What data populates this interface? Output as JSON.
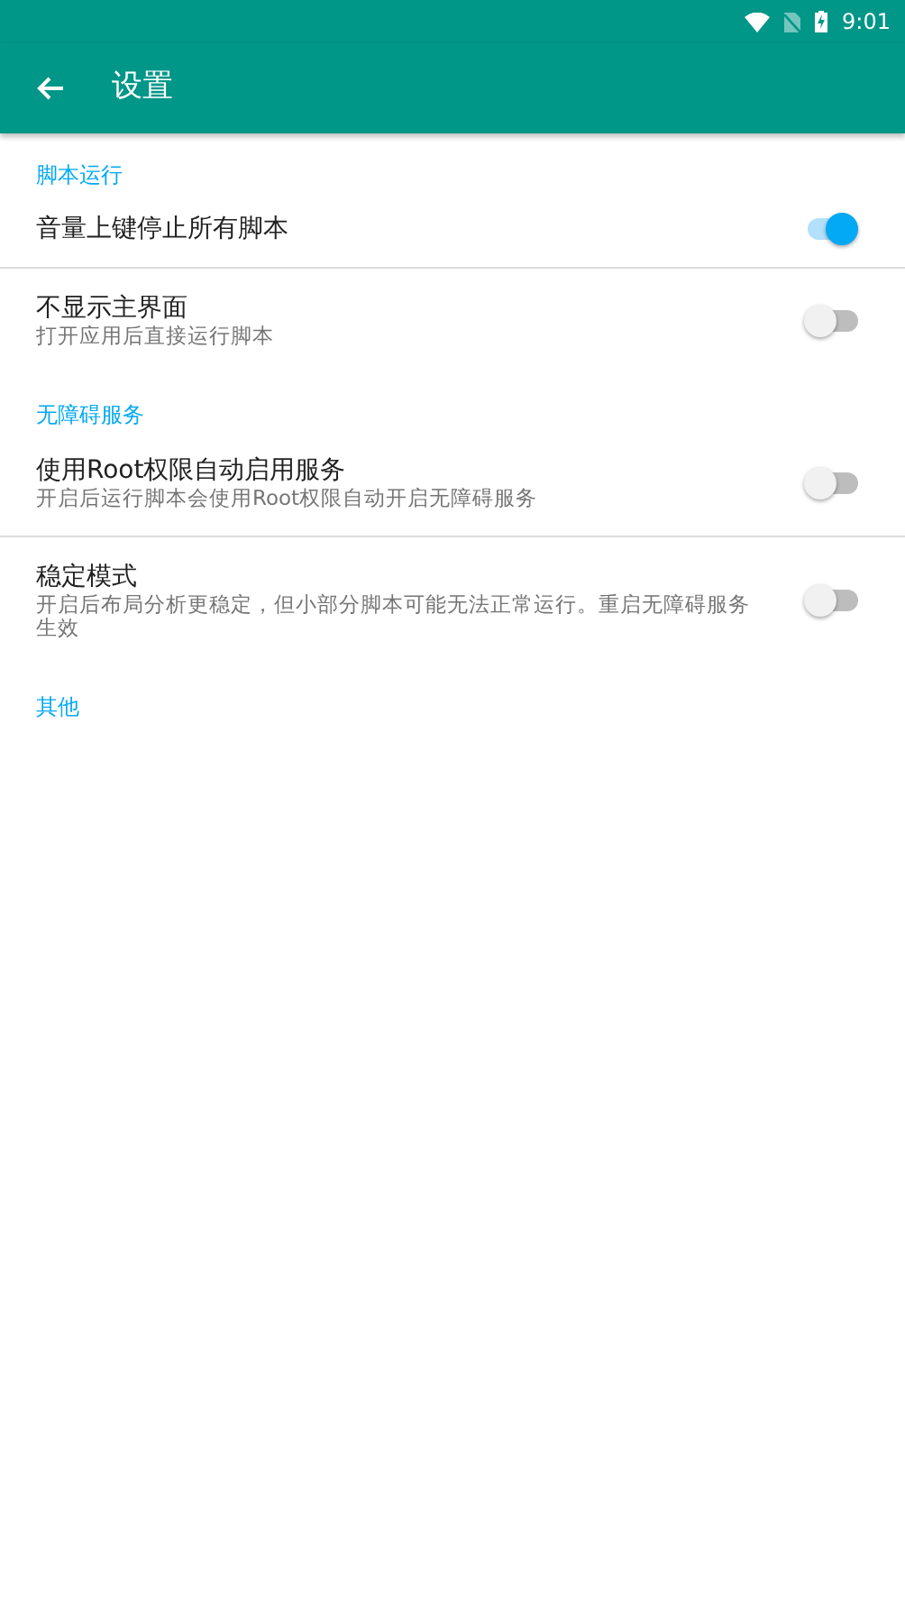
{
  "status_bar": {
    "time": "9:01"
  },
  "toolbar": {
    "title": "设置"
  },
  "sections": [
    {
      "title": "脚本运行",
      "items": [
        {
          "title": "音量上键停止所有脚本",
          "on": true
        },
        {
          "title": "不显示主界面",
          "summary": "打开应用后直接运行脚本",
          "on": false
        }
      ]
    },
    {
      "title": "无障碍服务",
      "items": [
        {
          "title": "使用Root权限自动启用服务",
          "summary": "开启后运行脚本会使用Root权限自动开启无障碍服务",
          "on": false
        },
        {
          "title": "稳定模式",
          "summary": "开启后布局分析更稳定，但小部分脚本可能无法正常运行。重启无障碍服务生效",
          "on": false
        }
      ]
    },
    {
      "title": "其他"
    }
  ]
}
